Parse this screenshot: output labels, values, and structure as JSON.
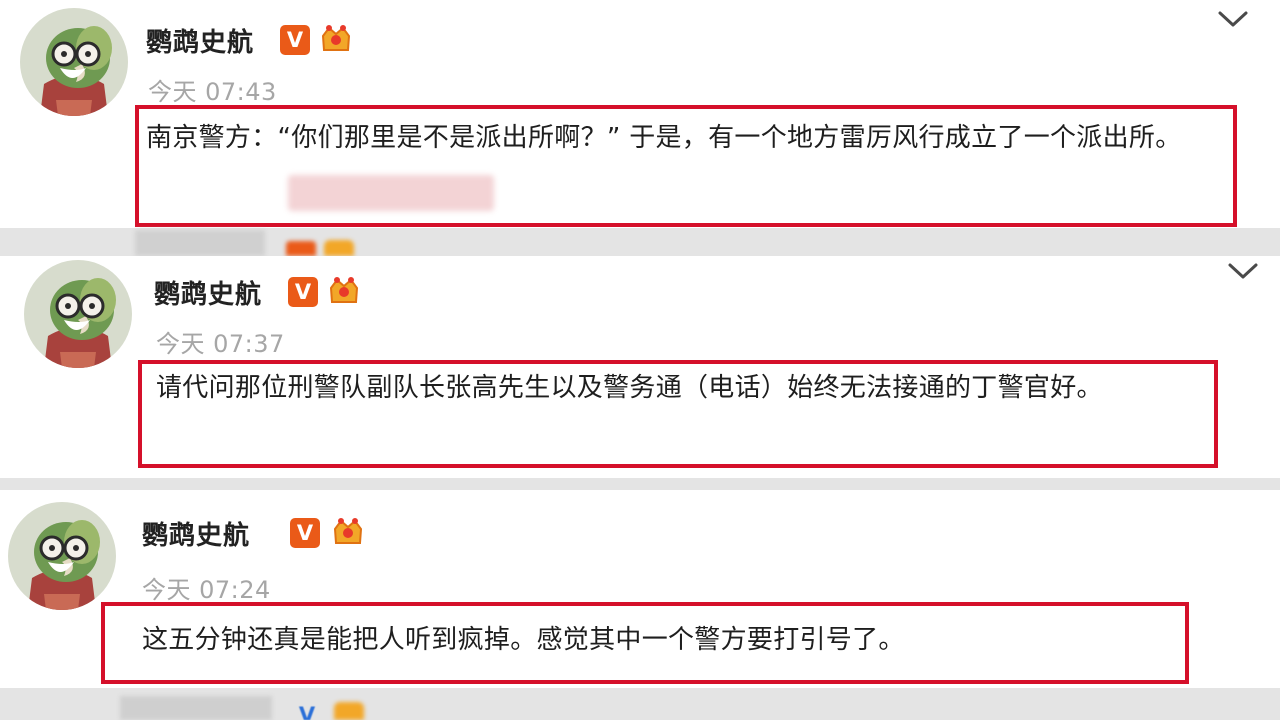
{
  "colors": {
    "page_bg": "#e4e4e4",
    "card_bg": "#ffffff",
    "highlight_red": "#d5102a",
    "verified_orange": "#ea5a18",
    "username_text": "#222222",
    "timestamp_text": "#a6a6a6",
    "body_text": "#1e1e1e"
  },
  "posts": [
    {
      "username": "鹦鹉史航",
      "verified_badge": "V",
      "timestamp": "今天 07:43",
      "content": "南京警方：“你们那里是不是派出所啊？” 于是，有一个地方雷厉风行成立了一个派出所。",
      "icons": [
        "avatar-parrot",
        "verified-v-icon",
        "member-crown-icon",
        "chevron-down-icon"
      ]
    },
    {
      "username": "鹦鹉史航",
      "verified_badge": "V",
      "timestamp": "今天 07:37",
      "content": "请代问那位刑警队副队长张高先生以及警务通（电话）始终无法接通的丁警官好。",
      "icons": [
        "avatar-parrot",
        "verified-v-icon",
        "member-crown-icon",
        "chevron-down-icon"
      ]
    },
    {
      "username": "鹦鹉史航",
      "verified_badge": "V",
      "timestamp": "今天 07:24",
      "content": "这五分钟还真是能把人听到疯掉。感觉其中一个警方要打引号了。",
      "icons": [
        "avatar-parrot",
        "verified-v-icon",
        "member-crown-icon"
      ]
    }
  ],
  "peeking_rows": [
    {
      "verified_badge": "V"
    },
    {
      "verified_badge": "V"
    }
  ]
}
